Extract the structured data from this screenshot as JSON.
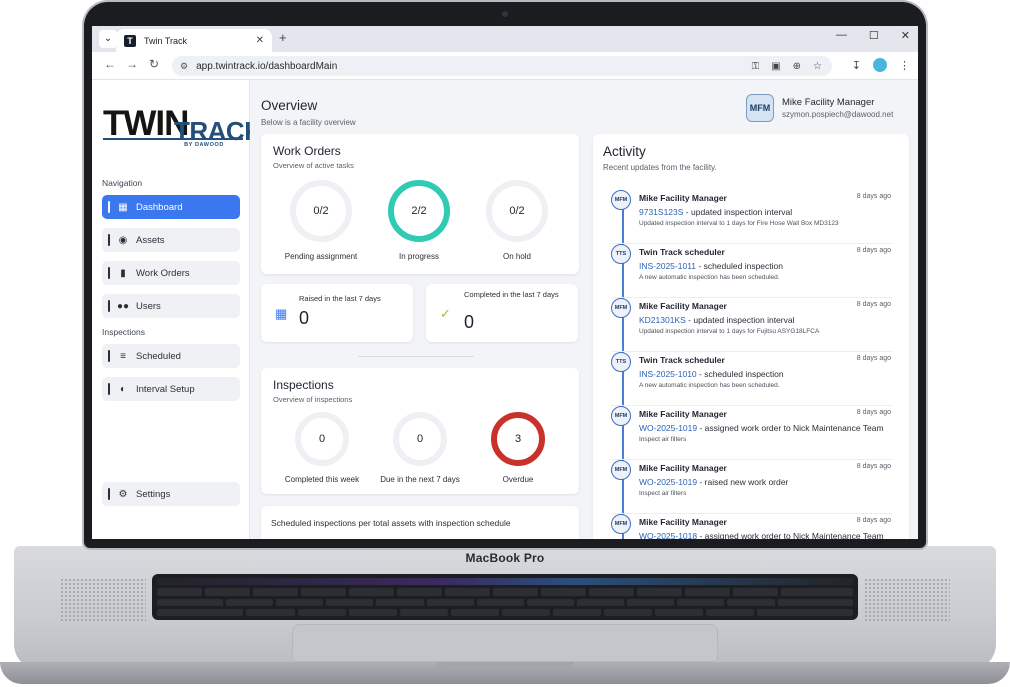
{
  "device": {
    "label": "MacBook Pro"
  },
  "browser": {
    "tab_title": "Twin Track",
    "favicon_letter": "T",
    "url": "app.twintrack.io/dashboardMain"
  },
  "logo": {
    "twin": "TWIN",
    "track": "TRACK",
    "by": "BY DAWOOD"
  },
  "sidebar": {
    "nav_label": "Navigation",
    "items": [
      {
        "label": "Dashboard",
        "icon": "dashboard-icon"
      },
      {
        "label": "Assets",
        "icon": "assets-icon"
      },
      {
        "label": "Work Orders",
        "icon": "work-orders-icon"
      },
      {
        "label": "Users",
        "icon": "users-icon"
      }
    ],
    "inspections_label": "Inspections",
    "inspection_items": [
      {
        "label": "Scheduled",
        "icon": "scheduled-icon"
      },
      {
        "label": "Interval Setup",
        "icon": "interval-icon"
      }
    ],
    "settings_label": "Settings"
  },
  "header": {
    "title": "Overview",
    "subtitle": "Below is a facility overview",
    "user_initials": "MFM",
    "user_name": "Mike Facility Manager",
    "user_email": "szymon.pospiech@dawood.net"
  },
  "work_orders": {
    "title": "Work Orders",
    "subtitle": "Overview of active tasks",
    "stats": [
      {
        "value": "0/2",
        "label": "Pending assignment"
      },
      {
        "value": "2/2",
        "label": "In progress"
      },
      {
        "value": "0/2",
        "label": "On hold"
      }
    ]
  },
  "raised": {
    "caption": "Raised in the last 7 days",
    "value": "0"
  },
  "completed": {
    "caption": "Completed in the last 7 days",
    "value": "0"
  },
  "inspections": {
    "title": "Inspections",
    "subtitle": "Overview of inspections",
    "stats": [
      {
        "value": "0",
        "label": "Completed this week"
      },
      {
        "value": "0",
        "label": "Due in the next 7 days"
      },
      {
        "value": "3",
        "label": "Overdue"
      }
    ]
  },
  "schedule_card": {
    "title": "Scheduled inspections per total assets with inspection schedule"
  },
  "activity": {
    "title": "Activity",
    "subtitle": "Recent updates from the facility.",
    "items": [
      {
        "initials": "MFM",
        "who": "Mike Facility Manager",
        "when": "8 days ago",
        "ref": "9731S123S",
        "action": " - updated inspection interval",
        "detail": "Updated inspection interval to 1 days for Fire Hose Wall Box MD3123"
      },
      {
        "initials": "TTS",
        "who": "Twin Track scheduler",
        "when": "8 days ago",
        "ref": "INS-2025-1011",
        "action": " - scheduled inspection",
        "detail": "A new automatic inspection has been scheduled."
      },
      {
        "initials": "MFM",
        "who": "Mike Facility Manager",
        "when": "8 days ago",
        "ref": "KD21301KS",
        "action": " - updated inspection interval",
        "detail": "Updated inspection interval to 1 days for Fujitsu ASYG18LFCA"
      },
      {
        "initials": "TTS",
        "who": "Twin Track scheduler",
        "when": "8 days ago",
        "ref": "INS-2025-1010",
        "action": " - scheduled inspection",
        "detail": "A new automatic inspection has been scheduled."
      },
      {
        "initials": "MFM",
        "who": "Mike Facility Manager",
        "when": "8 days ago",
        "ref": "WO-2025-1019",
        "action": " - assigned work order to Nick Maintenance Team",
        "detail": "Inspect air filters"
      },
      {
        "initials": "MFM",
        "who": "Mike Facility Manager",
        "when": "8 days ago",
        "ref": "WO-2025-1019",
        "action": " - raised new work order",
        "detail": "Inspect air filters"
      },
      {
        "initials": "MFM",
        "who": "Mike Facility Manager",
        "when": "8 days ago",
        "ref": "WO-2025-1018",
        "action": " - assigned work order to Nick Maintenance Team",
        "detail": ""
      }
    ]
  },
  "colors": {
    "accent": "#3b78ef",
    "in_progress": "#2fcbb2",
    "overdue": "#c8322a",
    "brand": "#234f78"
  }
}
